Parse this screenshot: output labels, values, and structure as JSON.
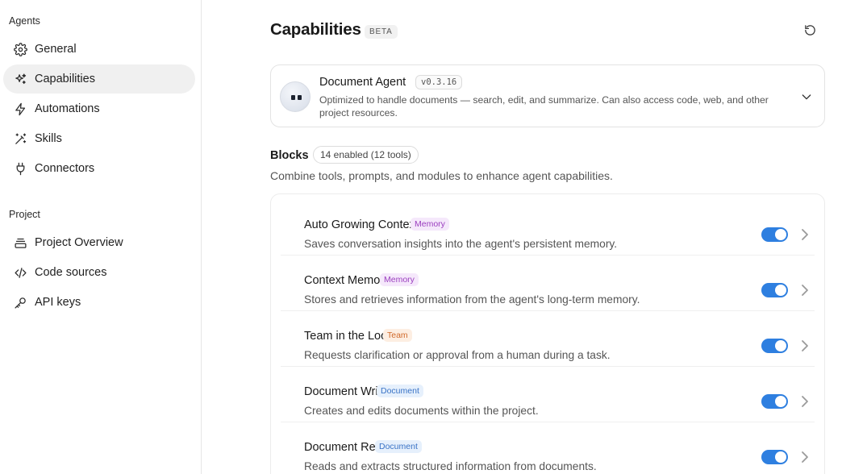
{
  "sidebar": {
    "agents_label": "Agents",
    "project_label": "Project",
    "agent_items": [
      {
        "label": "General",
        "icon": "gear-icon"
      },
      {
        "label": "Capabilities",
        "icon": "sparkle-icon",
        "active": true
      },
      {
        "label": "Automations",
        "icon": "bolt-icon"
      },
      {
        "label": "Skills",
        "icon": "magic-wand-icon"
      },
      {
        "label": "Connectors",
        "icon": "plug-icon"
      }
    ],
    "project_items": [
      {
        "label": "Project Overview",
        "icon": "layers-icon"
      },
      {
        "label": "Code sources",
        "icon": "code-icon"
      },
      {
        "label": "API keys",
        "icon": "key-icon"
      }
    ]
  },
  "header": {
    "title": "Capabilities",
    "badge": "BETA"
  },
  "agent": {
    "name": "Document Agent",
    "version": "v0.3.16",
    "description": "Optimized to handle documents — search, edit, and summarize. Can also access code, web, and other project resources."
  },
  "blocks": {
    "title": "Blocks",
    "count": "14 enabled (12 tools)",
    "subtitle": "Combine tools, prompts, and modules to enhance agent capabilities.",
    "items": [
      {
        "name": "Auto Growing Context",
        "tag": "Memory",
        "tag_type": "memory",
        "description": "Saves conversation insights into the agent's persistent memory.",
        "enabled": true
      },
      {
        "name": "Context Memory",
        "tag": "Memory",
        "tag_type": "memory",
        "description": "Stores and retrieves information from the agent's long-term memory.",
        "enabled": true
      },
      {
        "name": "Team in the Loop",
        "tag": "Team",
        "tag_type": "team",
        "description": "Requests clarification or approval from a human during a task.",
        "enabled": true
      },
      {
        "name": "Document Write",
        "tag": "Document",
        "tag_type": "document",
        "description": "Creates and edits documents within the project.",
        "enabled": true
      },
      {
        "name": "Document Read",
        "tag": "Document",
        "tag_type": "document",
        "description": "Reads and extracts structured information from documents.",
        "enabled": true
      }
    ]
  },
  "colors": {
    "toggle_on": "#2e7fe0",
    "active_nav": "#f0f0f0"
  }
}
